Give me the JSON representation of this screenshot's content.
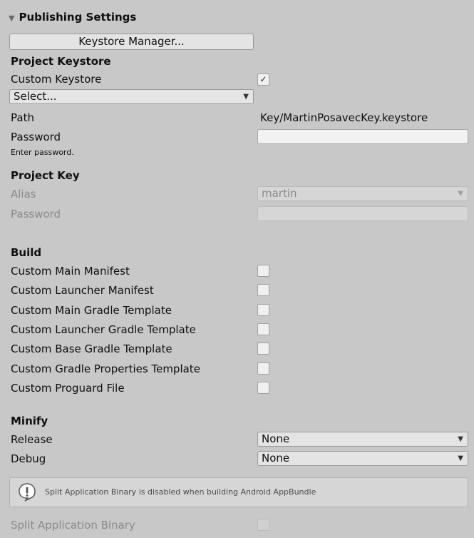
{
  "foldout": {
    "arrow": "▼",
    "title": "Publishing Settings"
  },
  "keystore_manager_button": "Keystore Manager...",
  "project_keystore": {
    "header": "Project Keystore",
    "custom_keystore_label": "Custom Keystore",
    "custom_keystore_checked": "✓",
    "select_value": "Select...",
    "path_label": "Path",
    "path_value": "Key/MartinPosavecKey.keystore",
    "password_label": "Password",
    "password_value": "",
    "hint": "Enter password."
  },
  "project_key": {
    "header": "Project Key",
    "alias_label": "Alias",
    "alias_value": "martin",
    "password_label": "Password"
  },
  "build": {
    "header": "Build",
    "items": [
      "Custom Main Manifest",
      "Custom Launcher Manifest",
      "Custom Main Gradle Template",
      "Custom Launcher Gradle Template",
      "Custom Base Gradle Template",
      "Custom Gradle Properties Template",
      "Custom Proguard File"
    ]
  },
  "minify": {
    "header": "Minify",
    "release_label": "Release",
    "release_value": "None",
    "debug_label": "Debug",
    "debug_value": "None"
  },
  "help": {
    "icon": "warning-icon",
    "message": "Split Application Binary is disabled when building Android AppBundle"
  },
  "split_binary_label": "Split Application Binary",
  "icons": {
    "caret": "▼"
  }
}
